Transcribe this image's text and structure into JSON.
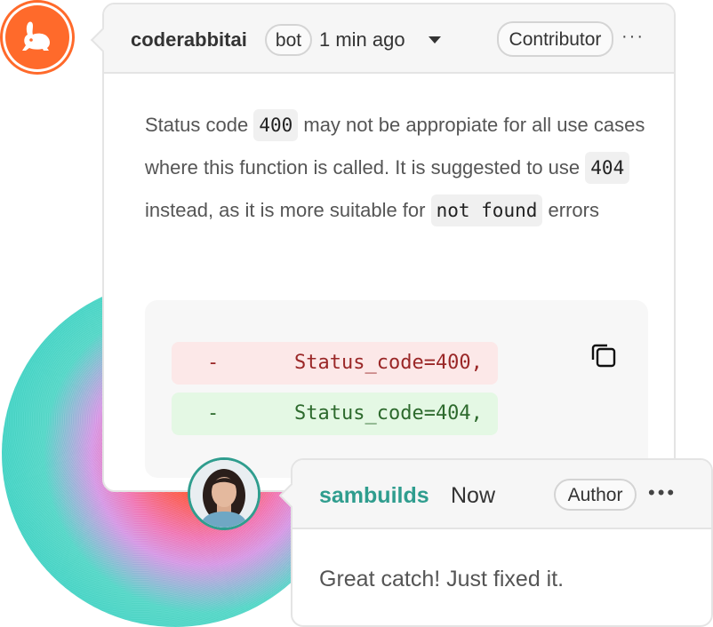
{
  "comment": {
    "author": "coderabbitai",
    "bot_badge": "bot",
    "time": "1 min ago",
    "role_badge": "Contributor",
    "more": "···",
    "body": {
      "p1": "Status code ",
      "code1": "400",
      "p2": " may not be appropiate for all use cases where this function is called. It is suggested to use ",
      "code2": "404",
      "p3": " instead, as it is more suitable for ",
      "code3": "not found",
      "p4": " errors"
    },
    "diff": {
      "removed_sign": "-",
      "removed_code": "Status_code=400,",
      "added_sign": "-",
      "added_code": "Status_code=404,"
    }
  },
  "reply": {
    "author": "sambuilds",
    "time": "Now",
    "role_badge": "Author",
    "more": "•••",
    "body": "Great catch! Just fixed it."
  },
  "colors": {
    "brand_orange": "#ff6a2b",
    "reply_author": "#2f9d8e",
    "diff_removed_bg": "#fce8e8",
    "diff_added_bg": "#e4f8e4"
  },
  "icons": {
    "bot_avatar": "rabbit-icon",
    "copy": "copy-icon",
    "dropdown": "chevron-down-icon"
  }
}
